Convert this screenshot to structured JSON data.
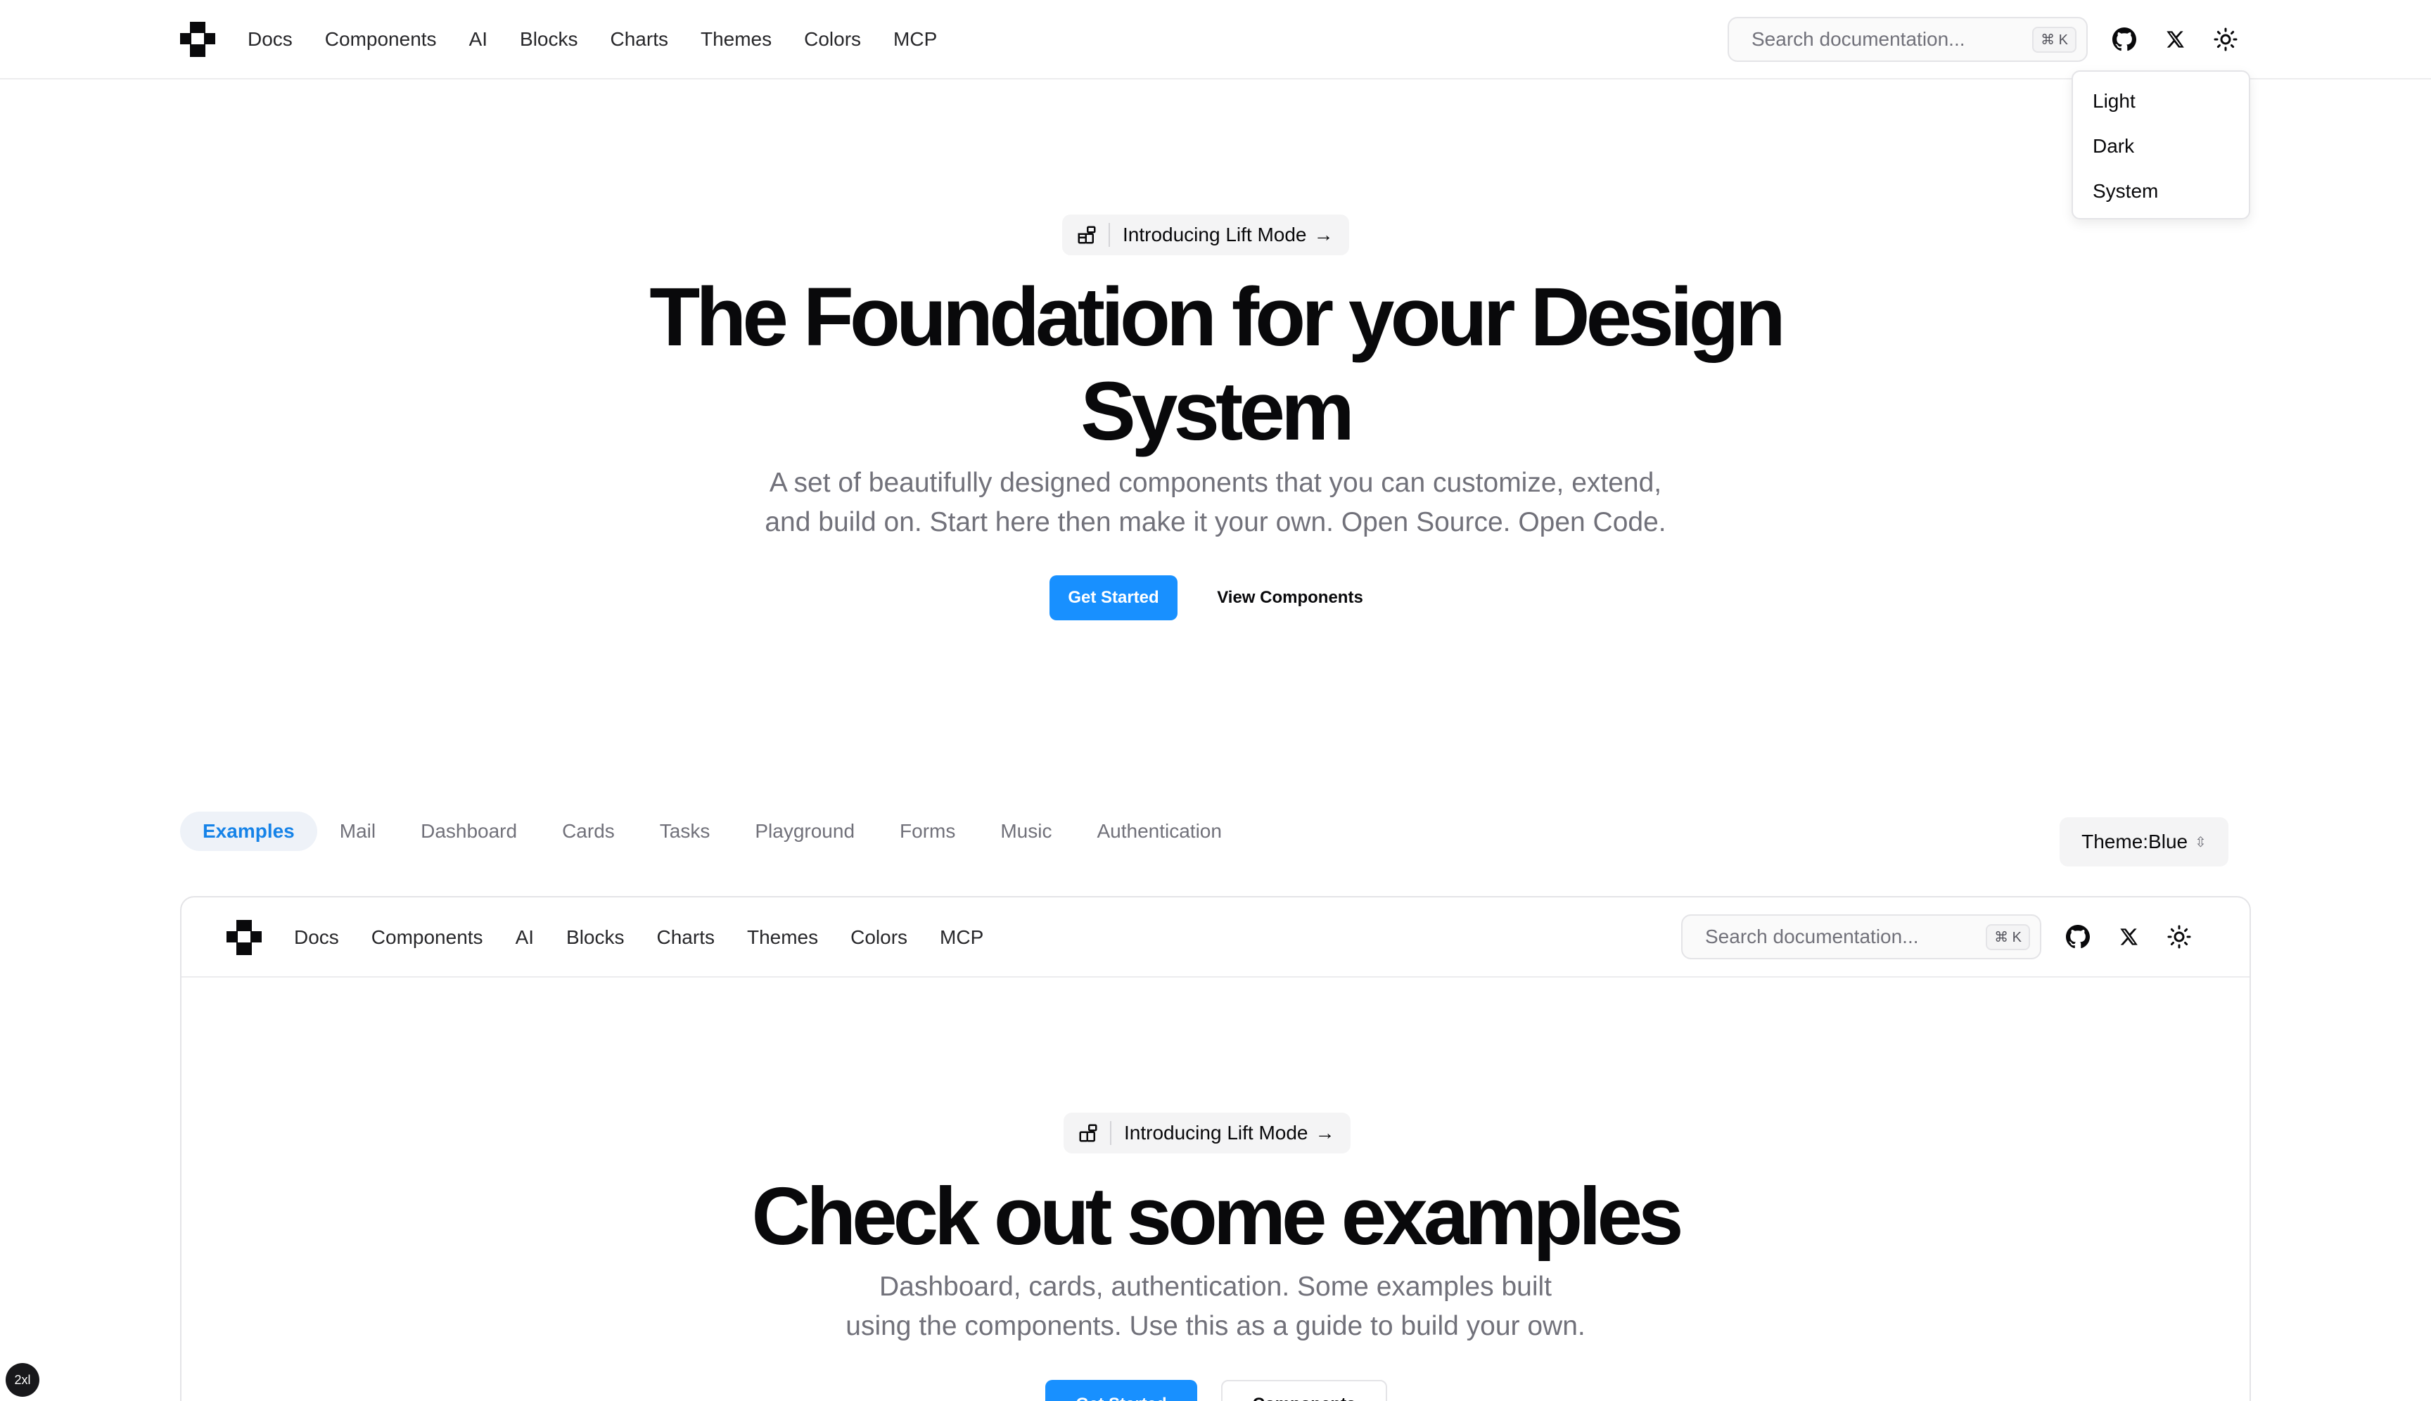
{
  "nav": {
    "links": [
      "Docs",
      "Components",
      "AI",
      "Blocks",
      "Charts",
      "Themes",
      "Colors",
      "MCP"
    ],
    "search_placeholder": "Search documentation...",
    "search_shortcut": "⌘ K"
  },
  "theme_menu": {
    "items": [
      "Light",
      "Dark",
      "System"
    ]
  },
  "hero": {
    "badge_label": "Introducing Lift Mode",
    "headline_line1": "The Foundation for your Design",
    "headline_line2": "System",
    "subtext_line1": "A set of beautifully designed components that you can customize, extend,",
    "subtext_line2": "and build on. Start here then make it your own. Open Source. Open Code.",
    "primary_button": "Get Started",
    "secondary_button": "View Components"
  },
  "examples": {
    "tabs": [
      "Examples",
      "Mail",
      "Dashboard",
      "Cards",
      "Tasks",
      "Playground",
      "Forms",
      "Music",
      "Authentication"
    ],
    "active_tab": "Examples",
    "theme_label": "Theme:Blue"
  },
  "preview": {
    "nav_links": [
      "Docs",
      "Components",
      "AI",
      "Blocks",
      "Charts",
      "Themes",
      "Colors",
      "MCP"
    ],
    "search_placeholder": "Search documentation...",
    "search_shortcut": "⌘ K",
    "badge_label": "Introducing Lift Mode",
    "headline": "Check out some examples",
    "subtext_line1": "Dashboard, cards, authentication. Some examples built",
    "subtext_line2": "using the components. Use this as a guide to build your own.",
    "primary_button": "Get Started",
    "secondary_button": "Components"
  },
  "breakpoint_indicator": "2xl",
  "colors": {
    "accent": "#1890ff",
    "active_tab_text": "#1683e8",
    "active_tab_bg": "#eef2f8",
    "text": "#09090b",
    "muted": "#71717a"
  },
  "icons": {
    "logo": "brand-logo",
    "github": "github-icon",
    "x": "x-icon",
    "theme": "sun-icon",
    "badge": "blocks-icon",
    "select": "chevrons-up-down-icon"
  }
}
